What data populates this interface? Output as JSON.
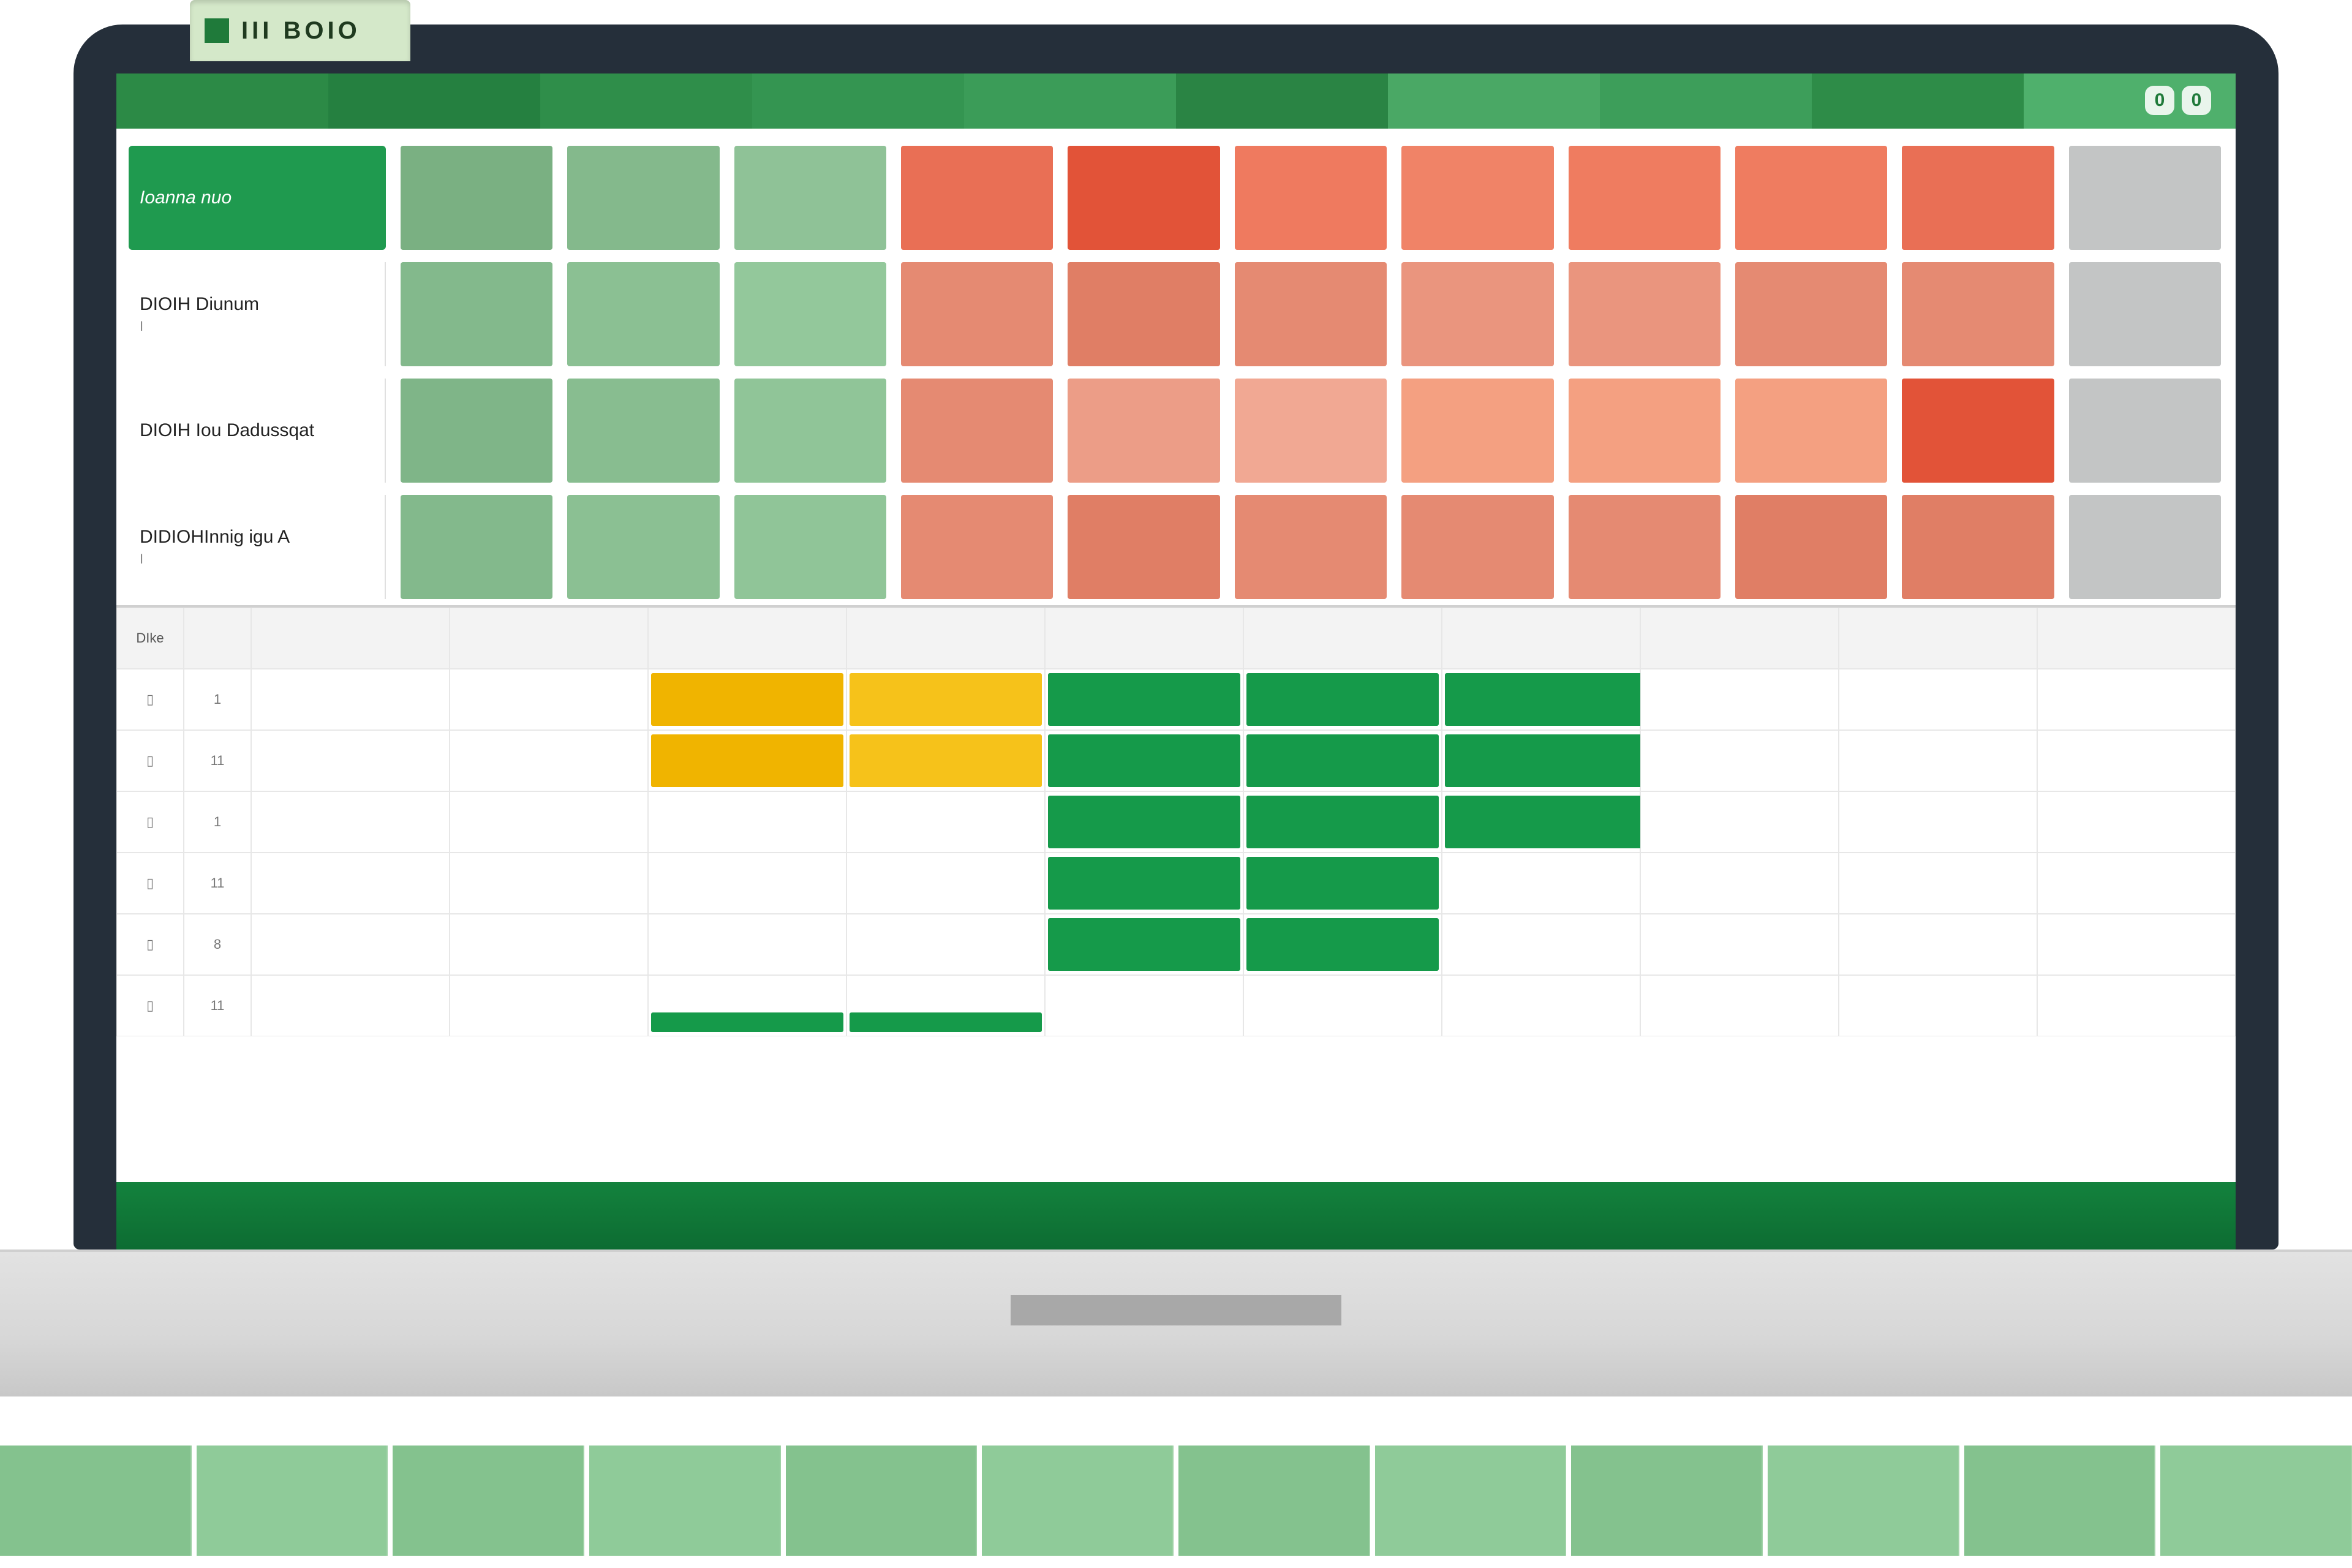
{
  "tab": {
    "label": "III BOIO"
  },
  "badges": [
    "0",
    "0"
  ],
  "heatmap": {
    "rows": [
      {
        "label": "Ioanna nuo",
        "sub": ""
      },
      {
        "label": "DIOIH Diunum",
        "sub": "I"
      },
      {
        "label": "DIOIH Iou Dadussqat",
        "sub": ""
      },
      {
        "label": "DIDIOHInnig igu A",
        "sub": "I"
      }
    ],
    "cells": [
      [
        "#7ab082",
        "#84b98c",
        "#8fc297",
        "#e96f55",
        "#e25338",
        "#ef7a5f",
        "#f08367",
        "#ef7c60",
        "#ef7c60",
        "#e96f55",
        "#c3c5c5"
      ],
      [
        "#83b98c",
        "#8bc093",
        "#93c89b",
        "#e58a72",
        "#e07e65",
        "#e58a72",
        "#ea957e",
        "#ea957e",
        "#e58a72",
        "#e58a72",
        "#c3c5c5"
      ],
      [
        "#7fb588",
        "#88bd90",
        "#90c598",
        "#e58a72",
        "#ec9d87",
        "#f1a893",
        "#f4a081",
        "#f4a081",
        "#f4a081",
        "#e25338",
        "#c3c5c5"
      ],
      [
        "#83b98c",
        "#8bc093",
        "#90c598",
        "#e58a72",
        "#e07e65",
        "#e58a72",
        "#e58a72",
        "#e58a72",
        "#e07e65",
        "#e07e65",
        "#c3c5c5"
      ]
    ]
  },
  "lower": {
    "header_a": "DIke",
    "header_b": "",
    "row_labels_a": [
      "▯",
      "▯",
      "▯",
      "▯",
      "▯",
      "▯"
    ],
    "row_labels_b": [
      "1",
      "11",
      "1",
      "11",
      "8",
      "11"
    ]
  },
  "chart_data": {
    "type": "heatmap",
    "title": "",
    "row_labels": [
      "Ioanna nuo",
      "DIOIH Diunum",
      "DIOIH Iou Dadussqat",
      "DIDIOHInnig igu A"
    ],
    "col_count": 11,
    "values_color": [
      [
        "#7ab082",
        "#84b98c",
        "#8fc297",
        "#e96f55",
        "#e25338",
        "#ef7a5f",
        "#f08367",
        "#ef7c60",
        "#ef7c60",
        "#e96f55",
        "#c3c5c5"
      ],
      [
        "#83b98c",
        "#8bc093",
        "#93c89b",
        "#e58a72",
        "#e07e65",
        "#e58a72",
        "#ea957e",
        "#ea957e",
        "#e58a72",
        "#e58a72",
        "#c3c5c5"
      ],
      [
        "#7fb588",
        "#88bd90",
        "#90c598",
        "#e58a72",
        "#ec9d87",
        "#f1a893",
        "#f4a081",
        "#f4a081",
        "#f4a081",
        "#e25338",
        "#c3c5c5"
      ],
      [
        "#83b98c",
        "#8bc093",
        "#90c598",
        "#e58a72",
        "#e07e65",
        "#e58a72",
        "#e58a72",
        "#e58a72",
        "#e07e65",
        "#e07e65",
        "#c3c5c5"
      ]
    ],
    "legend": {
      "low": "green",
      "high": "red",
      "na": "grey"
    }
  }
}
